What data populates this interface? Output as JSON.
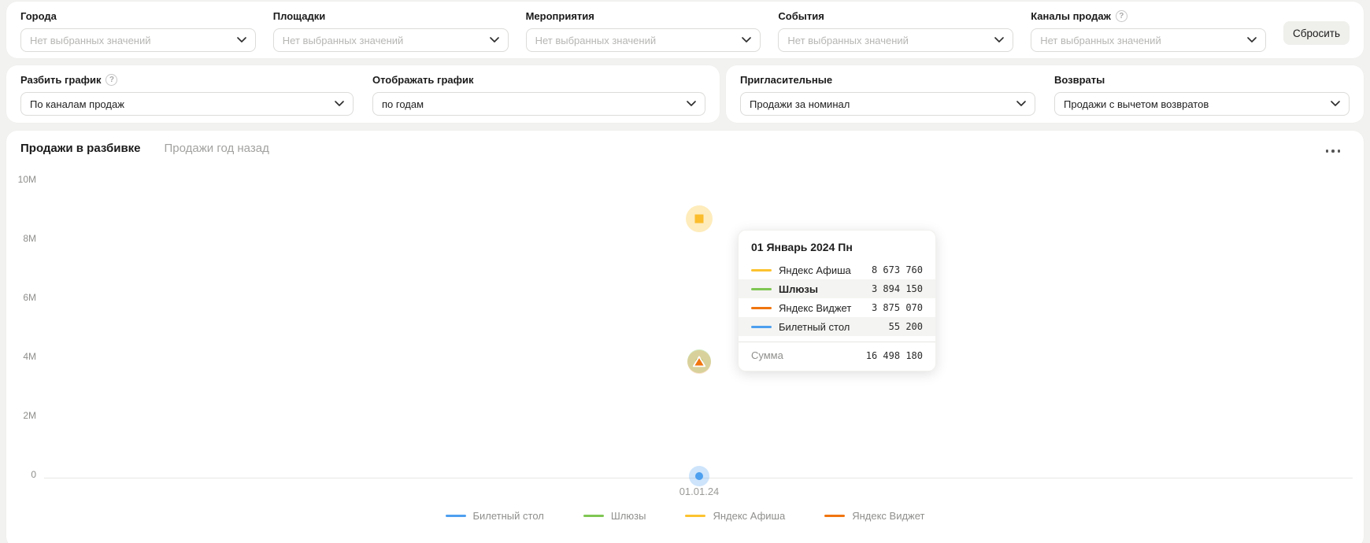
{
  "filters_row1": {
    "items": [
      {
        "label": "Города",
        "placeholder": "Нет выбранных значений"
      },
      {
        "label": "Площадки",
        "placeholder": "Нет выбранных значений"
      },
      {
        "label": "Мероприятия",
        "placeholder": "Нет выбранных значений"
      },
      {
        "label": "События",
        "placeholder": "Нет выбранных значений"
      },
      {
        "label": "Каналы продаж",
        "placeholder": "Нет выбранных значений",
        "has_help": true
      }
    ],
    "reset_label": "Сбросить"
  },
  "filters_row2": {
    "split_chart": {
      "label": "Разбить график",
      "value": "По каналам продаж",
      "has_help": true
    },
    "display_chart": {
      "label": "Отображать график",
      "value": "по годам"
    },
    "invitations": {
      "label": "Пригласительные",
      "value": "Продажи за номинал"
    },
    "refunds": {
      "label": "Возвраты",
      "value": "Продажи с вычетом возвратов"
    }
  },
  "icons": {
    "help": "?"
  },
  "chart": {
    "tabs": [
      {
        "label": "Продажи в разбивке",
        "active": true
      },
      {
        "label": "Продажи год назад",
        "active": false
      }
    ]
  },
  "chart_data": {
    "type": "line",
    "title": "Продажи в разбивке",
    "x": [
      "01.01.24"
    ],
    "series": [
      {
        "name": "Билетный стол",
        "color": "#4d9fef",
        "marker": "circle",
        "values": [
          55200
        ]
      },
      {
        "name": "Шлюзы",
        "color": "#7fc653",
        "marker": "circle",
        "values": [
          3894150
        ]
      },
      {
        "name": "Яндекс Афиша",
        "color": "#fcc32f",
        "marker": "square",
        "values": [
          8673760
        ]
      },
      {
        "name": "Яндекс Виджет",
        "color": "#f0750f",
        "marker": "triangle",
        "values": [
          3875070
        ]
      }
    ],
    "ylim": [
      0,
      10000000
    ],
    "yticks": [
      "10M",
      "8M",
      "6M",
      "4M",
      "2M",
      "0"
    ],
    "grid": false,
    "legend_position": "bottom"
  },
  "legend": {
    "items": [
      {
        "label": "Билетный стол",
        "color": "#4d9fef"
      },
      {
        "label": "Шлюзы",
        "color": "#7fc653"
      },
      {
        "label": "Яндекс Афиша",
        "color": "#fcc32f"
      },
      {
        "label": "Яндекс Виджет",
        "color": "#f0750f"
      }
    ]
  },
  "tooltip": {
    "title": "01 Январь 2024 Пн",
    "rows": [
      {
        "name": "Яндекс Афиша",
        "value": "8 673 760",
        "color": "#fcc32f",
        "bold": false
      },
      {
        "name": "Шлюзы",
        "value": "3 894 150",
        "color": "#7fc653",
        "bold": true
      },
      {
        "name": "Яндекс Виджет",
        "value": "3 875 070",
        "color": "#f0750f",
        "bold": false
      },
      {
        "name": "Билетный стол",
        "value": "55 200",
        "color": "#4d9fef",
        "bold": false
      }
    ],
    "total_label": "Сумма",
    "total_value": "16 498 180"
  }
}
